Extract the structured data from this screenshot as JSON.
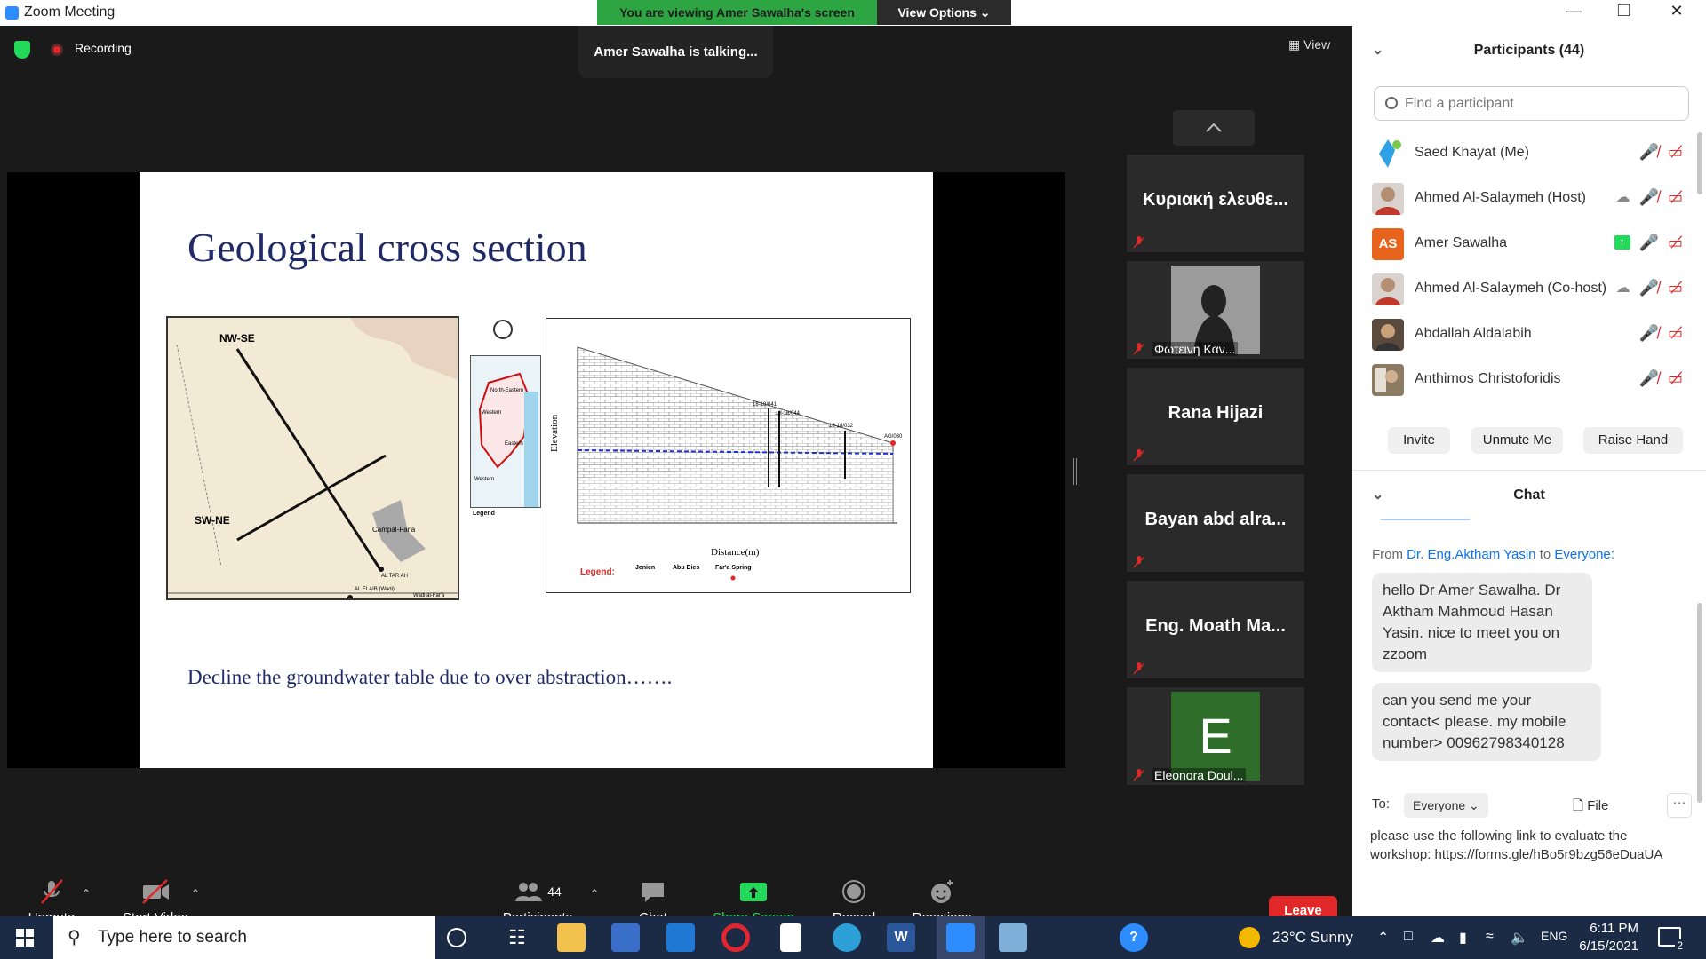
{
  "window": {
    "title": "Zoom Meeting"
  },
  "banner": {
    "viewing": "You are viewing Amer Sawalha's screen",
    "view_options": "View Options"
  },
  "meeting": {
    "recording": "Recording",
    "talking": "Amer Sawalha is talking...",
    "view": "View"
  },
  "slide": {
    "title": "Geological cross section",
    "caption": "Decline the groundwater table  due to over abstraction…….",
    "map_labels": [
      "NW-SE",
      "SW-NE",
      "Legend",
      "Campal-Far'a",
      "AL TAR AH",
      "AL ELAIB (Wadi)",
      "Wadi al-Far'a"
    ],
    "inset_labels": [
      "North-Eastern",
      "Western",
      "Eastern",
      "Western"
    ],
    "xsection": {
      "ylabel": "Elevation",
      "xlabel": "Distance(m)",
      "legend_label": "Legend:",
      "legend_items": [
        "Jenien",
        "Abu Dies",
        "Far'a Spring"
      ],
      "wells": [
        "18-18/041",
        "18-18/044",
        "18-18/032",
        "AG/030"
      ]
    }
  },
  "thumbnails": [
    {
      "name": "Κυριακή ελευθε...",
      "label": ""
    },
    {
      "name": "",
      "label": "Φωτεινη Καν..."
    },
    {
      "name": "Rana Hijazi",
      "label": ""
    },
    {
      "name": "Bayan abd  alra...",
      "label": ""
    },
    {
      "name": "Eng. Moath Ma...",
      "label": ""
    },
    {
      "name": "E",
      "label": "Eleonora Doul..."
    }
  ],
  "toolbar": {
    "unmute": "Unmute",
    "start_video": "Start Video",
    "participants": "Participants",
    "participants_count": "44",
    "chat": "Chat",
    "share_screen": "Share Screen",
    "record": "Record",
    "reactions": "Reactions",
    "leave": "Leave"
  },
  "participants_panel": {
    "title": "Participants (44)",
    "search_placeholder": "Find a participant",
    "list": [
      {
        "name": "Saed Khayat (Me)"
      },
      {
        "name": "Ahmed Al-Salaymeh (Host)"
      },
      {
        "name": "Amer Sawalha",
        "initials": "AS"
      },
      {
        "name": "Ahmed Al-Salaymeh (Co-host)"
      },
      {
        "name": "Abdallah Aldalabih"
      },
      {
        "name": "Anthimos Christoforidis"
      }
    ],
    "buttons": {
      "invite": "Invite",
      "unmute_me": "Unmute Me",
      "raise_hand": "Raise Hand"
    }
  },
  "chat_panel": {
    "title": "Chat",
    "from_prefix": "From",
    "from_name": "Dr. Eng.Aktham Yasin",
    "to_word": "to",
    "to_name": "Everyone:",
    "messages": [
      "hello Dr Amer Sawalha. Dr Aktham Mahmoud Hasan Yasin. nice to meet you on zzoom",
      "can you send me your contact< please. my mobile number> 00962798340128"
    ],
    "to_label": "To:",
    "to_select": "Everyone",
    "file_label": "File",
    "compose_text": "please use the following link to evaluate the workshop: https://forms.gle/hBo5r9bzg56eDuaUA"
  },
  "taskbar": {
    "search_placeholder": "Type here to search",
    "weather": "23°C  Sunny",
    "lang": "ENG",
    "time": "6:11 PM",
    "date": "6/15/2021",
    "notifications": "2"
  },
  "colors": {
    "accent": "#2d8cff",
    "share_green": "#23d959",
    "leave_red": "#e02828",
    "slide_navy": "#1f2a66",
    "link": "#0e72ed"
  }
}
